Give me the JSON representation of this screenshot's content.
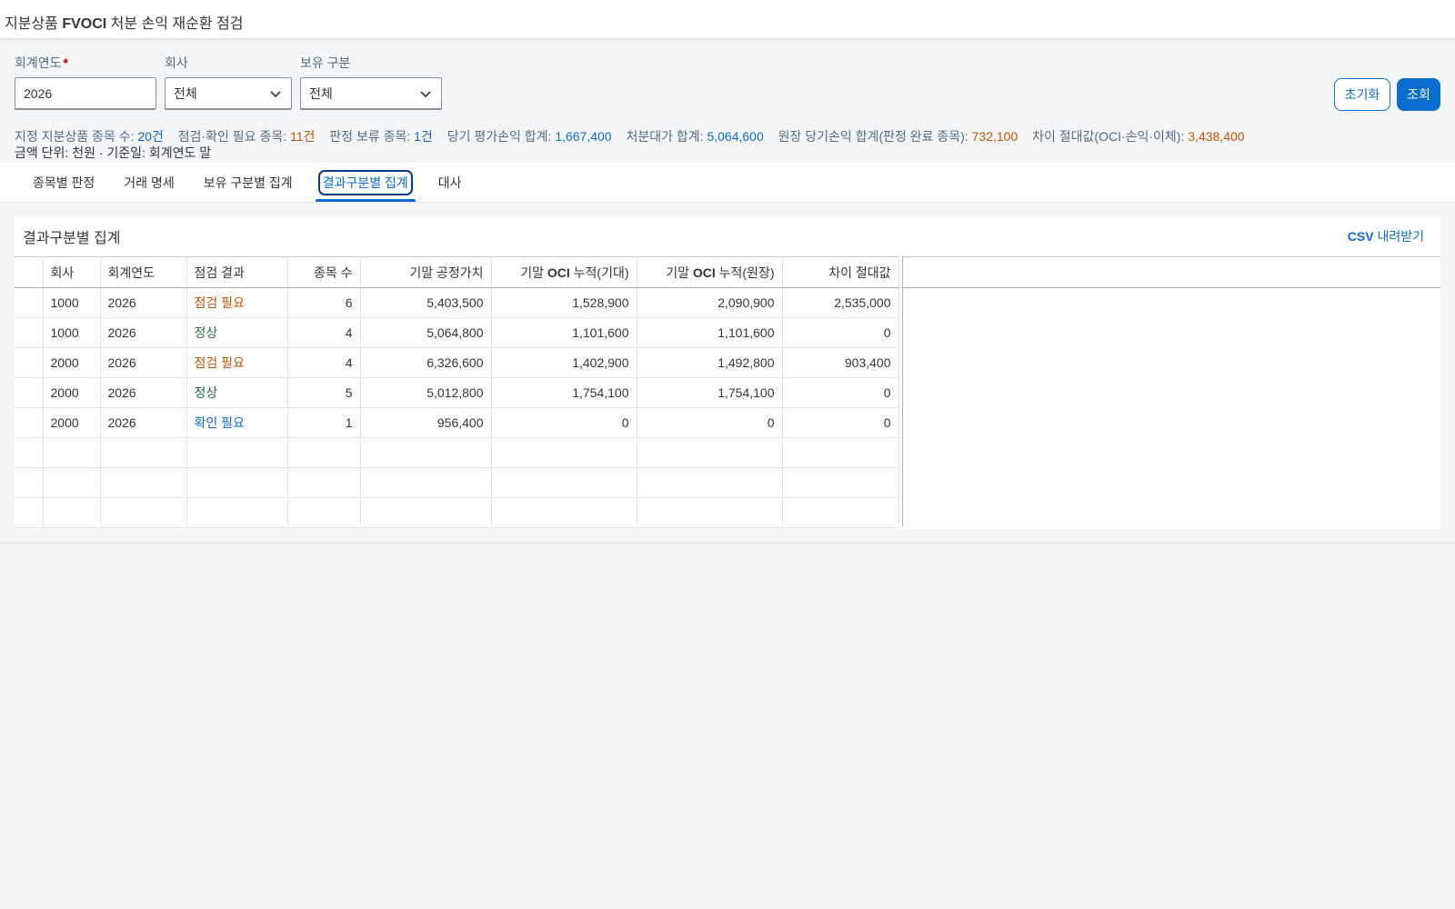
{
  "app": {
    "title_prefix": "지분상품 ",
    "title_bold": "FVOCI",
    "title_suffix": " 처분 손익 재순환 점검"
  },
  "filters": {
    "year_label": "회계연도",
    "year_required_mark": "*",
    "year_value": "2026",
    "company_label": "회사",
    "company_value": "전체",
    "holding_label": "보유 구분",
    "holding_value": "전체",
    "reset_label": "초기화",
    "search_label": "조회"
  },
  "summary": {
    "designated_label": "지정 지분상품 종목 수:",
    "designated_value": "20건",
    "check_label": "점검·확인 필요 종목:",
    "check_value": "11건",
    "pending_label": "판정 보류 종목:",
    "pending_value": "1건",
    "valuation_label": "당기 평가손익 합계:",
    "valuation_value": "1,667,400",
    "disposal_label": "처분대가 합계:",
    "disposal_value": "5,064,600",
    "ledger_label": "원장 당기손익 합계(판정 완료 종목):",
    "ledger_value": "732,100",
    "diff_label": "차이 절대값(OCI·손익·이체):",
    "diff_value": "3,438,400",
    "unit_line": "금액 단위: 천원 · 기준일: 회계연도 말"
  },
  "tabs": {
    "tab1": "종목별 판정",
    "tab2": "거래 명세",
    "tab3": "보유 구분별 집계",
    "tab4": "결과구분별 집계",
    "tab5": "대사"
  },
  "panel": {
    "title": "결과구분별 집계",
    "csv_bold": "CSV",
    "csv_rest": " 내려받기"
  },
  "table": {
    "headers": {
      "company": "회사",
      "year": "회계연도",
      "result": "점검 결과",
      "count": "종목 수",
      "fair_value": "기말 공정가치",
      "oci_expected_pre": "기말 ",
      "oci_bold": "OCI",
      "oci_expected_post": " 누적(기대)",
      "oci_ledger_pre": "기말 ",
      "oci_ledger_post": " 누적(원장)",
      "diff": "차이 절대값"
    },
    "rows": [
      {
        "company": "1000",
        "year": "2026",
        "result": "점검 필요",
        "status": "warn",
        "count": "6",
        "fair_value": "5,403,500",
        "oci_expected": "1,528,900",
        "oci_ledger": "2,090,900",
        "diff": "2,535,000"
      },
      {
        "company": "1000",
        "year": "2026",
        "result": "정상",
        "status": "ok",
        "count": "4",
        "fair_value": "5,064,800",
        "oci_expected": "1,101,600",
        "oci_ledger": "1,101,600",
        "diff": "0"
      },
      {
        "company": "2000",
        "year": "2026",
        "result": "점검 필요",
        "status": "warn",
        "count": "4",
        "fair_value": "6,326,600",
        "oci_expected": "1,402,900",
        "oci_ledger": "1,492,800",
        "diff": "903,400"
      },
      {
        "company": "2000",
        "year": "2026",
        "result": "정상",
        "status": "ok",
        "count": "5",
        "fair_value": "5,012,800",
        "oci_expected": "1,754,100",
        "oci_ledger": "1,754,100",
        "diff": "0"
      },
      {
        "company": "2000",
        "year": "2026",
        "result": "확인 필요",
        "status": "info",
        "count": "1",
        "fair_value": "956,400",
        "oci_expected": "0",
        "oci_ledger": "0",
        "diff": "0"
      }
    ]
  },
  "colors": {
    "accent": "#0a6ed1",
    "warn": "#c35500",
    "ok": "#256f3a"
  }
}
